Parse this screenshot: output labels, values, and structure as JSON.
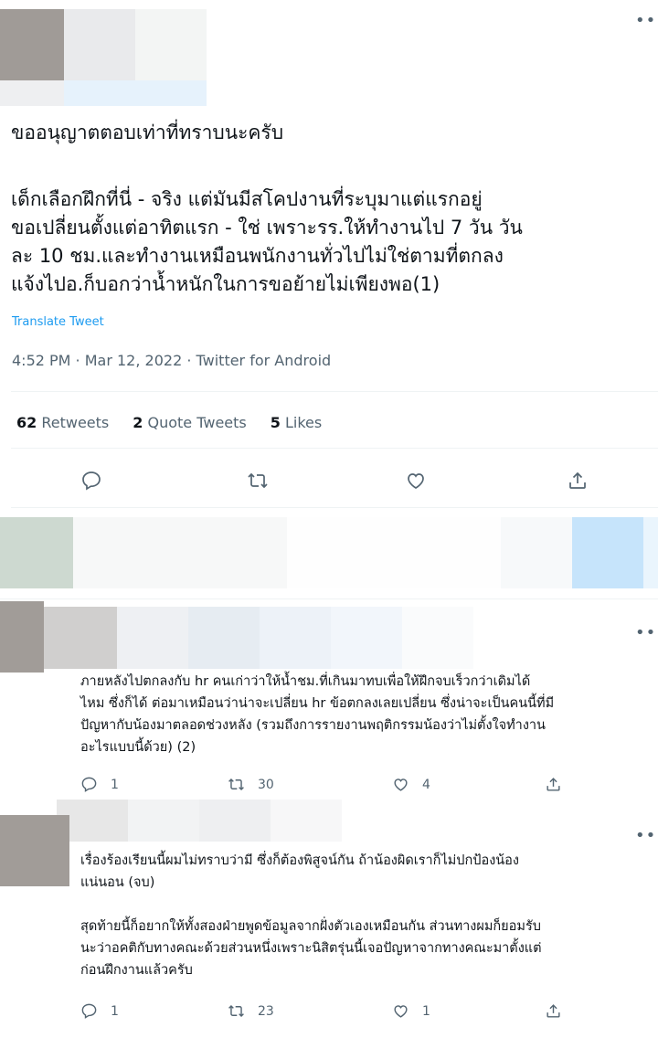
{
  "menu_icon": "more-horizontal-icon",
  "tweet": {
    "intro": "ขออนุญาตตอบเท่าที่ทราบนะครับ",
    "body_lines": [
      "เด็กเลือกฝึกที่นี่ - จริง แต่มันมีสโคปงานที่ระบุมาแต่แรกอยู่",
      "ขอเปลี่ยนตั้งแต่อาทิตแรก - ใช่ เพราะรร.ให้ทำงานไป 7 วัน วัน",
      "ละ 10 ชม.และทำงานเหมือนพนักงานทั่วไปไม่ใช่ตามที่ตกลง",
      "แจ้งไปอ.ก็บอกว่าน้ำหนักในการขอย้ายไม่เพียงพอ(1)"
    ],
    "translate_label": "Translate Tweet",
    "meta": "4:52 PM · Mar 12, 2022 · Twitter for Android",
    "stats": {
      "retweets_count": "62",
      "retweets_label": "Retweets",
      "quotes_count": "2",
      "quotes_label": "Quote Tweets",
      "likes_count": "5",
      "likes_label": "Likes"
    },
    "actions": [
      "reply-icon",
      "retweet-icon",
      "like-icon",
      "share-icon"
    ]
  },
  "replies": [
    {
      "lines": [
        "ภายหลังไปตกลงกับ hr คนเก่าว่าให้น้ำชม.ที่เกินมาทบเพื่อให้ฝึกจบเร็วกว่าเดิมได้",
        "ไหม ซึ่งก็ได้ ต่อมาเหมือนว่าน่าจะเปลี่ยน hr ข้อตกลงเลยเปลี่ยน ซึ่งน่าจะเป็นคนนี้ที่มี",
        "ปัญหากับน้องมาตลอดช่วงหลัง (รวมถึงการรายงานพฤติกรรมน้องว่าไม่ตั้งใจทำงาน",
        "อะไรแบบนี้ด้วย) (2)"
      ],
      "reply_count": "1",
      "retweet_count": "30",
      "like_count": "4"
    },
    {
      "lines": [
        "เรื่องร้องเรียนนี้ผมไม่ทราบว่ามี ซึ่งก็ต้องพิสูจน์กัน ถ้าน้องผิดเราก็ไม่ปกป้องน้อง",
        "แน่นอน (จบ)",
        "",
        "สุดท้ายนี้ก็อยากให้ทั้งสองฝ่ายพูดข้อมูลจากฝั่งตัวเองเหมือนกัน ส่วนทางผมก็ยอมรับ",
        "นะว่าอคติกับทางคณะด้วยส่วนหนึ่งเพราะนิสิตรุ่นนี้เจอปัญหาจากทางคณะมาตั้งแต่",
        "ก่อนฝึกงานแล้วครับ"
      ],
      "reply_count": "1",
      "retweet_count": "23",
      "like_count": "1"
    }
  ],
  "colors": {
    "text": "#0f1419",
    "secondary": "#536471",
    "link": "#1d9bf0",
    "divider": "#eff3f4"
  }
}
